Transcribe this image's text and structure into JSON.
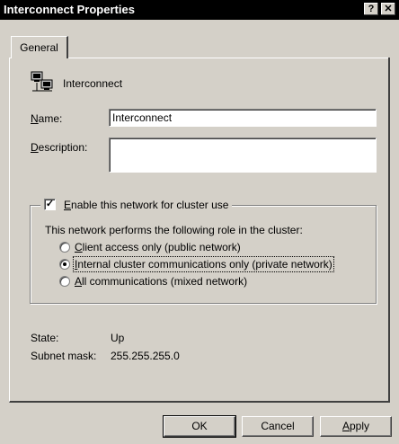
{
  "window": {
    "title": "Interconnect Properties"
  },
  "titlebar": {
    "help_label": "?",
    "close_label": "✕"
  },
  "tabs": [
    {
      "label": "General"
    }
  ],
  "header": {
    "icon": "network-connection-icon",
    "name": "Interconnect"
  },
  "form": {
    "name_label_underlined": "N",
    "name_label_rest": "ame:",
    "name_value": "Interconnect",
    "description_label_underlined": "D",
    "description_label_rest": "escription:",
    "description_value": ""
  },
  "cluster_use": {
    "checked": true,
    "label_underlined": "E",
    "label_rest": "nable this network for cluster use",
    "role_text": "This network performs the following role in the cluster:",
    "options": [
      {
        "u": "C",
        "rest": "lient access only (public network)",
        "selected": false
      },
      {
        "u": "I",
        "rest": "nternal cluster communications only (private network)",
        "selected": true
      },
      {
        "u": "A",
        "rest": "ll communications (mixed network)",
        "selected": false
      }
    ]
  },
  "info": {
    "state_label": "State:",
    "state_value": "Up",
    "subnet_label": "Subnet mask:",
    "subnet_value": "255.255.255.0"
  },
  "buttons": {
    "ok": "OK",
    "cancel": "Cancel",
    "apply_underlined": "A",
    "apply_rest": "pply"
  }
}
